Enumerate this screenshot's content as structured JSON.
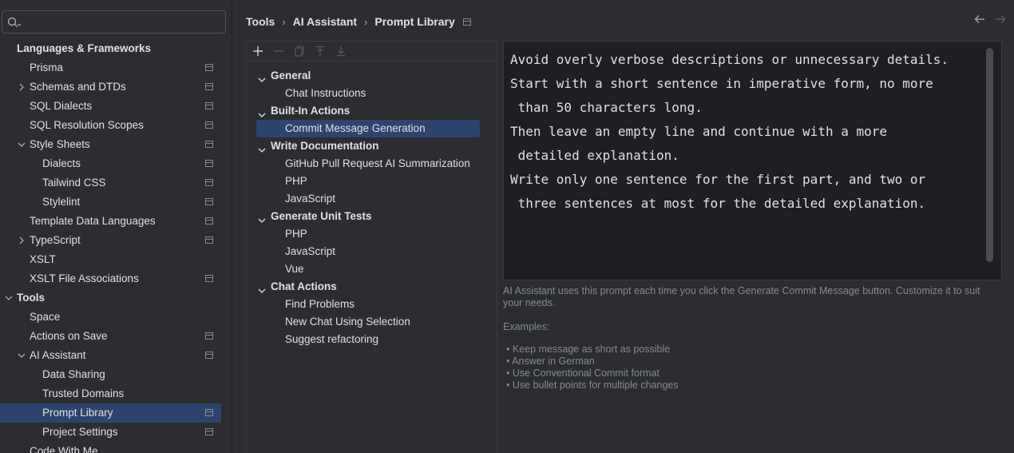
{
  "search": {
    "placeholder": "",
    "value": ""
  },
  "sidebar": {
    "items": [
      {
        "label": "Languages & Frameworks",
        "level": 0,
        "bold": true
      },
      {
        "label": "Prisma",
        "level": 1,
        "project": true
      },
      {
        "label": "Schemas and DTDs",
        "level": 1,
        "chevron": "right",
        "project": true
      },
      {
        "label": "SQL Dialects",
        "level": 1,
        "project": true
      },
      {
        "label": "SQL Resolution Scopes",
        "level": 1,
        "project": true
      },
      {
        "label": "Style Sheets",
        "level": 1,
        "chevron": "down",
        "project": true
      },
      {
        "label": "Dialects",
        "level": 2,
        "project": true
      },
      {
        "label": "Tailwind CSS",
        "level": 2,
        "project": true
      },
      {
        "label": "Stylelint",
        "level": 2,
        "project": true
      },
      {
        "label": "Template Data Languages",
        "level": 1,
        "project": true
      },
      {
        "label": "TypeScript",
        "level": 1,
        "chevron": "right",
        "project": true
      },
      {
        "label": "XSLT",
        "level": 1
      },
      {
        "label": "XSLT File Associations",
        "level": 1,
        "project": true
      },
      {
        "label": "Tools",
        "level": 0,
        "bold": true,
        "chevron": "down"
      },
      {
        "label": "Space",
        "level": 1
      },
      {
        "label": "Actions on Save",
        "level": 1,
        "project": true
      },
      {
        "label": "AI Assistant",
        "level": 1,
        "chevron": "down",
        "project": true
      },
      {
        "label": "Data Sharing",
        "level": 2
      },
      {
        "label": "Trusted Domains",
        "level": 2
      },
      {
        "label": "Prompt Library",
        "level": 2,
        "project": true,
        "selected": true
      },
      {
        "label": "Project Settings",
        "level": 2,
        "project": true
      },
      {
        "label": "Code With Me",
        "level": 1
      }
    ]
  },
  "header": {
    "breadcrumbs": [
      "Tools",
      "AI Assistant",
      "Prompt Library"
    ],
    "separator": "›"
  },
  "prompts": {
    "groups": [
      {
        "label": "General",
        "items": [
          "Chat Instructions"
        ]
      },
      {
        "label": "Built-In Actions",
        "items": [
          "Commit Message Generation"
        ]
      },
      {
        "label": "Write Documentation",
        "items": [
          "GitHub Pull Request AI Summarization",
          "PHP",
          "JavaScript"
        ]
      },
      {
        "label": "Generate Unit Tests",
        "items": [
          "PHP",
          "JavaScript",
          "Vue"
        ]
      },
      {
        "label": "Chat Actions",
        "items": [
          "Find Problems",
          "New Chat Using Selection",
          "Suggest refactoring"
        ]
      }
    ],
    "selected": "Commit Message Generation"
  },
  "editor": {
    "lines": [
      "Avoid overly verbose descriptions or unnecessary details.",
      "Start with a short sentence in imperative form, no more",
      " than 50 characters long.",
      "Then leave an empty line and continue with a more",
      " detailed explanation.",
      "Write only one sentence for the first part, and two or",
      " three sentences at most for the detailed explanation."
    ]
  },
  "description": "AI Assistant uses this prompt each time you click the Generate Commit Message button. Customize it to suit your needs.",
  "examples": {
    "label": "Examples:",
    "items": [
      "• Keep message as short as possible",
      "• Answer in German",
      "• Use Conventional Commit format",
      "• Use bullet points for multiple changes"
    ]
  },
  "colors": {
    "background": "#2b2d30",
    "editor_bg": "#1e1f22",
    "selection": "#2e436e",
    "muted_text": "#868a91"
  }
}
